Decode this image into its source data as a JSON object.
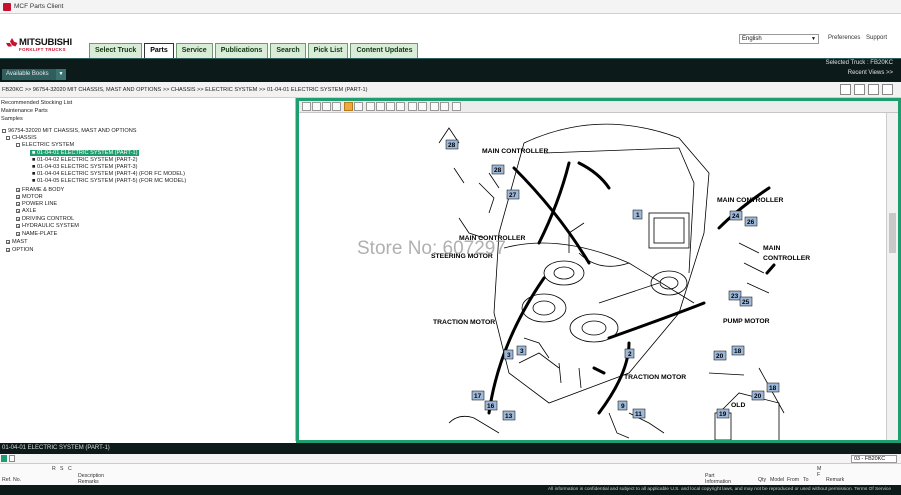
{
  "window": {
    "title": "MCF Parts Client"
  },
  "brand": {
    "name": "MITSUBISHI",
    "sub": "FORKLIFT TRUCKS"
  },
  "tabs": [
    {
      "label": "Select Truck"
    },
    {
      "label": "Parts"
    },
    {
      "label": "Service"
    },
    {
      "label": "Publications"
    },
    {
      "label": "Search"
    },
    {
      "label": "Pick List"
    },
    {
      "label": "Content Updates"
    }
  ],
  "language": {
    "value": "English"
  },
  "links": {
    "preferences": "Preferences",
    "support": "Support"
  },
  "selected_truck": "Selected Truck : FB20KC",
  "available_books": "Available Books",
  "recent_views": "Recent Views >>",
  "breadcrumb": "FB20KC >> 96754-32020 MIT CHASSIS, MAST AND OPTIONS >> CHASSIS >> ELECTRIC SYSTEM >> 01-04-01 ELECTRIC SYSTEM (PART-1)",
  "left_panel": {
    "links": [
      "Recommended Stocking List",
      "Maintenance Parts",
      "Samples"
    ],
    "tree": [
      {
        "label": "96754-32020 MIT CHASSIS, MAST AND OPTIONS"
      },
      {
        "label": "CHASSIS"
      },
      {
        "label": "ELECTRIC SYSTEM"
      },
      {
        "label": "01-04-01 ELECTRIC SYSTEM (PART-1)"
      },
      {
        "label": "01-04-02 ELECTRIC SYSTEM (PART-2)"
      },
      {
        "label": "01-04-03 ELECTRIC SYSTEM (PART-3)"
      },
      {
        "label": "01-04-04 ELECTRIC SYSTEM (PART-4) (FOR FC MODEL)"
      },
      {
        "label": "01-04-05 ELECTRIC SYSTEM (PART-5) (FOR MC MODEL)"
      },
      {
        "label": "FRAME & BODY"
      },
      {
        "label": "MOTOR"
      },
      {
        "label": "POWER LINE"
      },
      {
        "label": "AXLE"
      },
      {
        "label": "DRIVING CONTROL"
      },
      {
        "label": "HYDRAULIC SYSTEM"
      },
      {
        "label": "NAME-PLATE"
      },
      {
        "label": "MAST"
      },
      {
        "label": "OPTION"
      }
    ]
  },
  "drawing": {
    "watermark": "Store No: 607297",
    "labels": {
      "main_controller_1": "MAIN CONTROLLER",
      "main_controller_2": "MAIN CONTROLLER",
      "main_controller_3": "MAIN CONTROLLER",
      "main": "MAIN",
      "controller": "CONTROLLER",
      "steering_motor": "STEERING MOTOR",
      "traction_motor_1": "TRACTION MOTOR",
      "traction_motor_2": "TRACTION MOTOR",
      "pump_motor": "PUMP MOTOR",
      "old": "OLD"
    },
    "callouts": {
      "c28a": "28",
      "c28b": "28",
      "c27": "27",
      "c1": "1",
      "c24": "24",
      "c26": "26",
      "c23": "23",
      "c25": "25",
      "c2": "2",
      "c3a": "3",
      "c3b": "3",
      "c20a": "20",
      "c18a": "18",
      "c18b": "18",
      "c20b": "20",
      "c19": "19",
      "c17": "17",
      "c16": "16",
      "c13": "13",
      "c9": "9",
      "c11": "11"
    }
  },
  "bottom": {
    "title": "01-04-01 ELECTRIC SYSTEM (PART-1)",
    "truck_select": "03 - FB20KC",
    "columns": {
      "r": "R",
      "s": "S",
      "c": "C",
      "description": "Description",
      "remarks": "Remarks",
      "ref_no": "Ref. No.",
      "part": "Part",
      "information": "Information",
      "qty": "Qty",
      "model": "Model",
      "from": "From",
      "to": "To",
      "m": "M",
      "f": "F",
      "remark": "Remark"
    }
  },
  "footer": "All information is confidential and subject to all applicable U.S. and local copyright laws, and may not be reproduced or used without permission. Terms Of Service"
}
